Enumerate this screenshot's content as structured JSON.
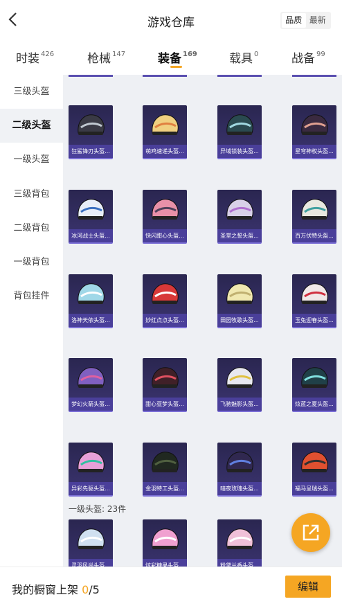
{
  "header": {
    "title": "游戏仓库",
    "sort": [
      "品质",
      "最新"
    ]
  },
  "tabs": [
    {
      "label": "时装",
      "count": "426"
    },
    {
      "label": "枪械",
      "count": "147"
    },
    {
      "label": "装备",
      "count": "169"
    },
    {
      "label": "载具",
      "count": "0"
    },
    {
      "label": "战备",
      "count": "99"
    }
  ],
  "sidebar": [
    "三级头盔",
    "二级头盔",
    "一级头盔",
    "三级背包",
    "二级背包",
    "一级背包",
    "背包挂件"
  ],
  "items": [
    {
      "label": "狂鲨锋刃头盔...",
      "color": "#3a3a45",
      "accent": "#c0c8d0"
    },
    {
      "label": "萌鸡速递头盔...",
      "color": "#f0d080",
      "accent": "#e08040"
    },
    {
      "label": "异域锁装头盔...",
      "color": "#2a4a50",
      "accent": "#a0d8e0"
    },
    {
      "label": "星穹神权头盔...",
      "color": "#3a2a40",
      "accent": "#e0a090"
    },
    {
      "label": "冰河战士头盔...",
      "color": "#e8eef8",
      "accent": "#3a70c0"
    },
    {
      "label": "快闪甜心头盔...",
      "color": "#e890a8",
      "accent": "#50405a"
    },
    {
      "label": "圣堂之誓头盔...",
      "color": "#d8d0e8",
      "accent": "#b070d0"
    },
    {
      "label": "百万伏特头盔...",
      "color": "#e8e8e0",
      "accent": "#40a0a0"
    },
    {
      "label": "洛神天依头盔...",
      "color": "#a0d8e8",
      "accent": "#ffffff"
    },
    {
      "label": "妙红点点头盔...",
      "color": "#d83838",
      "accent": "#ffffff"
    },
    {
      "label": "田园牧歌头盔...",
      "color": "#f0e8b0",
      "accent": "#c0b070"
    },
    {
      "label": "玉兔迎春头盔...",
      "color": "#f0e8e8",
      "accent": "#d03040"
    },
    {
      "label": "梦幻火箭头盔...",
      "color": "#8060c0",
      "accent": "#e060a0"
    },
    {
      "label": "甜心亚梦头盔...",
      "color": "#402028",
      "accent": "#e05060"
    },
    {
      "label": "飞驰魅影头盔...",
      "color": "#e8e8f0",
      "accent": "#e0c040"
    },
    {
      "label": "炫蓝之夏头盔...",
      "color": "#204048",
      "accent": "#80e0e0"
    },
    {
      "label": "异彩先驱头盔...",
      "color": "#e8a0d8",
      "accent": "#30c0a0"
    },
    {
      "label": "金羽特工头盔...",
      "color": "#202820",
      "accent": "#506040"
    },
    {
      "label": "暗夜玫瑰头盔...",
      "color": "#302850",
      "accent": "#6080e0"
    },
    {
      "label": "福马呈瑞头盔...",
      "color": "#e05030",
      "accent": "#303030"
    },
    {
      "label": "灵羽风尚头盔...",
      "color": "#d0e0f0",
      "accent": "#ffffff"
    },
    {
      "label": "炫彩糖果头盔...",
      "color": "#f0a0d0",
      "accent": "#ffffff"
    },
    {
      "label": "粉黛兰香头盔...",
      "color": "#f0c0d8",
      "accent": "#ffffff"
    }
  ],
  "section": {
    "label": "一级头盔: 23件"
  },
  "bottom": {
    "text": "我的橱窗上架 ",
    "current": "0",
    "total": "/5",
    "edit": "编辑"
  }
}
